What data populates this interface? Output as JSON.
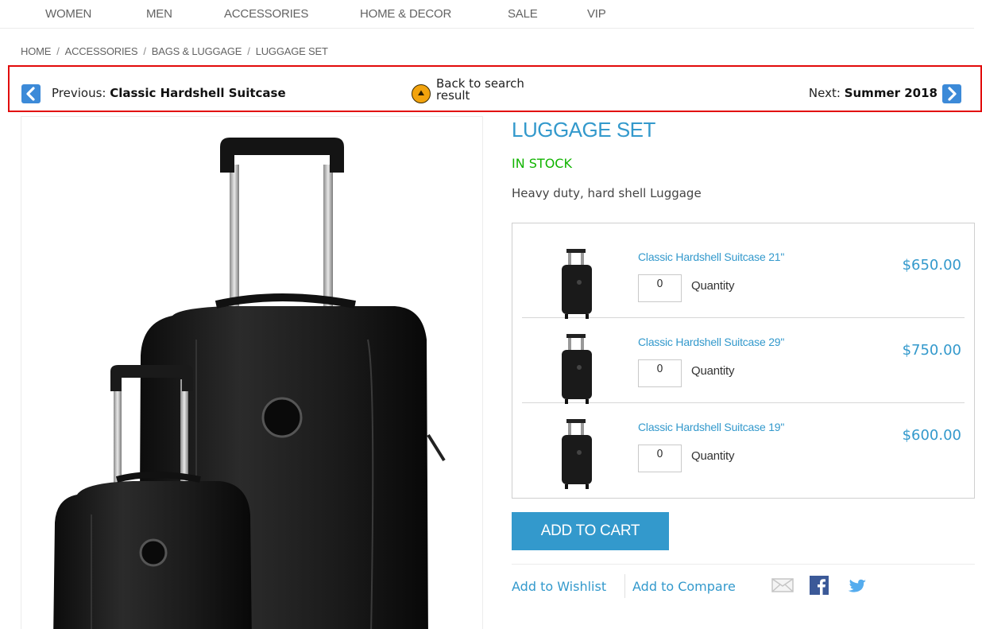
{
  "nav": {
    "items": [
      "WOMEN",
      "MEN",
      "ACCESSORIES",
      "HOME & DECOR",
      "SALE",
      "VIP"
    ]
  },
  "breadcrumb": {
    "items": [
      "HOME",
      "ACCESSORIES",
      "BAGS & LUGGAGE",
      "LUGGAGE SET"
    ],
    "separator": "/"
  },
  "product_nav": {
    "previous_label": "Previous:",
    "previous_name": "Classic Hardshell Suitcase",
    "back_line1": "Back to search",
    "back_line2": "result",
    "next_label": "Next:",
    "next_name": "Summer 2018"
  },
  "product": {
    "title": "LUGGAGE SET",
    "stock": "IN STOCK",
    "description": "Heavy duty, hard shell Luggage",
    "grouped": [
      {
        "name": "Classic Hardshell Suitcase 21\"",
        "qty": "0",
        "qty_label": "Quantity",
        "price": "$650.00"
      },
      {
        "name": "Classic Hardshell Suitcase 29\"",
        "qty": "0",
        "qty_label": "Quantity",
        "price": "$750.00"
      },
      {
        "name": "Classic Hardshell Suitcase 19\"",
        "qty": "0",
        "qty_label": "Quantity",
        "price": "$600.00"
      }
    ],
    "add_to_cart": "ADD TO CART",
    "add_to_wishlist": "Add to Wishlist",
    "add_to_compare": "Add to Compare"
  },
  "icons": {
    "share": [
      "email-icon",
      "facebook-icon",
      "twitter-icon"
    ]
  },
  "colors": {
    "accent": "#3399cc",
    "in_stock": "#11b400",
    "highlight_border": "#e20a0a"
  }
}
